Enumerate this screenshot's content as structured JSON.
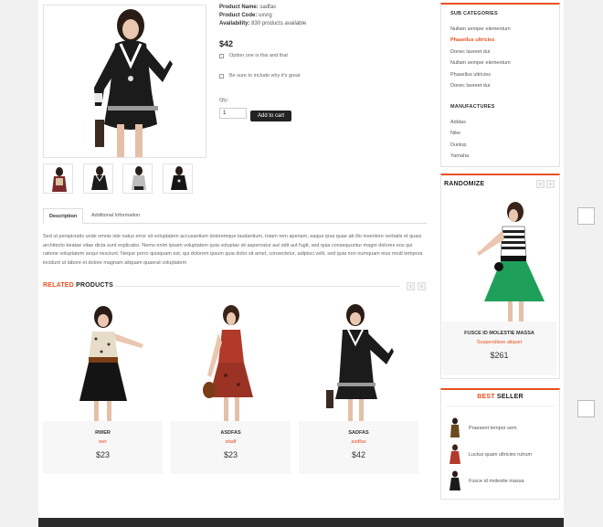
{
  "product": {
    "name_label": "Product Name:",
    "name_value": "sadfas",
    "code_label": "Product Code:",
    "code_value": "uxvrg",
    "availability_label": "Availability:",
    "availability_value": "830 products available",
    "price": "$42",
    "options": [
      "Option one is this and that",
      "Be sure to include why it's great"
    ],
    "qty_label": "Qty:",
    "qty_value": "1",
    "add_to_cart": "Add to cart"
  },
  "tabs": [
    "Description",
    "Additional Information"
  ],
  "description": "Sed ut perspiciatis unde omnis iste natus error sit voluptatem accusantium doloremque laudantium, totam rem aperiam, eaque ipsa quae ab illo inventore veritatis et quasi architecto beatae vitae dicta sunt explicabo. Nemo enim ipsam voluptatem quia voluptas sit aspernatur aut odit aut fugit, sed quia consequuntur magni dolores eos qui ratione voluptatem sequi nesciunt. Neque porro quisquam est, qui dolorem ipsum quia dolor sit amet, consectetur, adipisci velit, sed quia non numquam eius modi tempora incidunt ut labore et dolore magnam aliquam quaerat voluptatem",
  "related": {
    "title_accent": "RELATED",
    "title_rest": " PRODUCTS",
    "prev": "‹",
    "next": "›",
    "items": [
      {
        "name": "RWER",
        "sub": "wer",
        "price": "$23"
      },
      {
        "name": "ASDFAS",
        "sub": "sfadf",
        "price": "$23"
      },
      {
        "name": "SADFAS",
        "sub": "asdfas",
        "price": "$42"
      }
    ]
  },
  "sidebar": {
    "subcategories_title": "SUB CATEGORIES",
    "subcategories": [
      "Nullam semper elementum",
      "Phasellus ultricies",
      "Donec laoreet dui",
      "Nullam semper elementum",
      "Phasellus ultricies",
      "Donec laoreet dui"
    ],
    "manufactures_title": "MANUFACTURES",
    "manufactures": [
      "Adidas",
      "Nike",
      "Dunlop",
      "Yamaha"
    ],
    "randomize_title": "RANDOMIZE",
    "randomize_item": {
      "name": "FUSCE ID MOLESTIE MASSA",
      "sub": "Suspendisse aliquet",
      "price": "$261"
    },
    "best_accent": "BEST",
    "best_rest": " SELLER",
    "best_items": [
      "Praesent tempor sem",
      "Luctus quam ultricies rutrum",
      "Fusce id molestie massa"
    ]
  },
  "colors": {
    "accent": "#e8511f",
    "button": "#222222",
    "footer": "#2b2b2b"
  }
}
